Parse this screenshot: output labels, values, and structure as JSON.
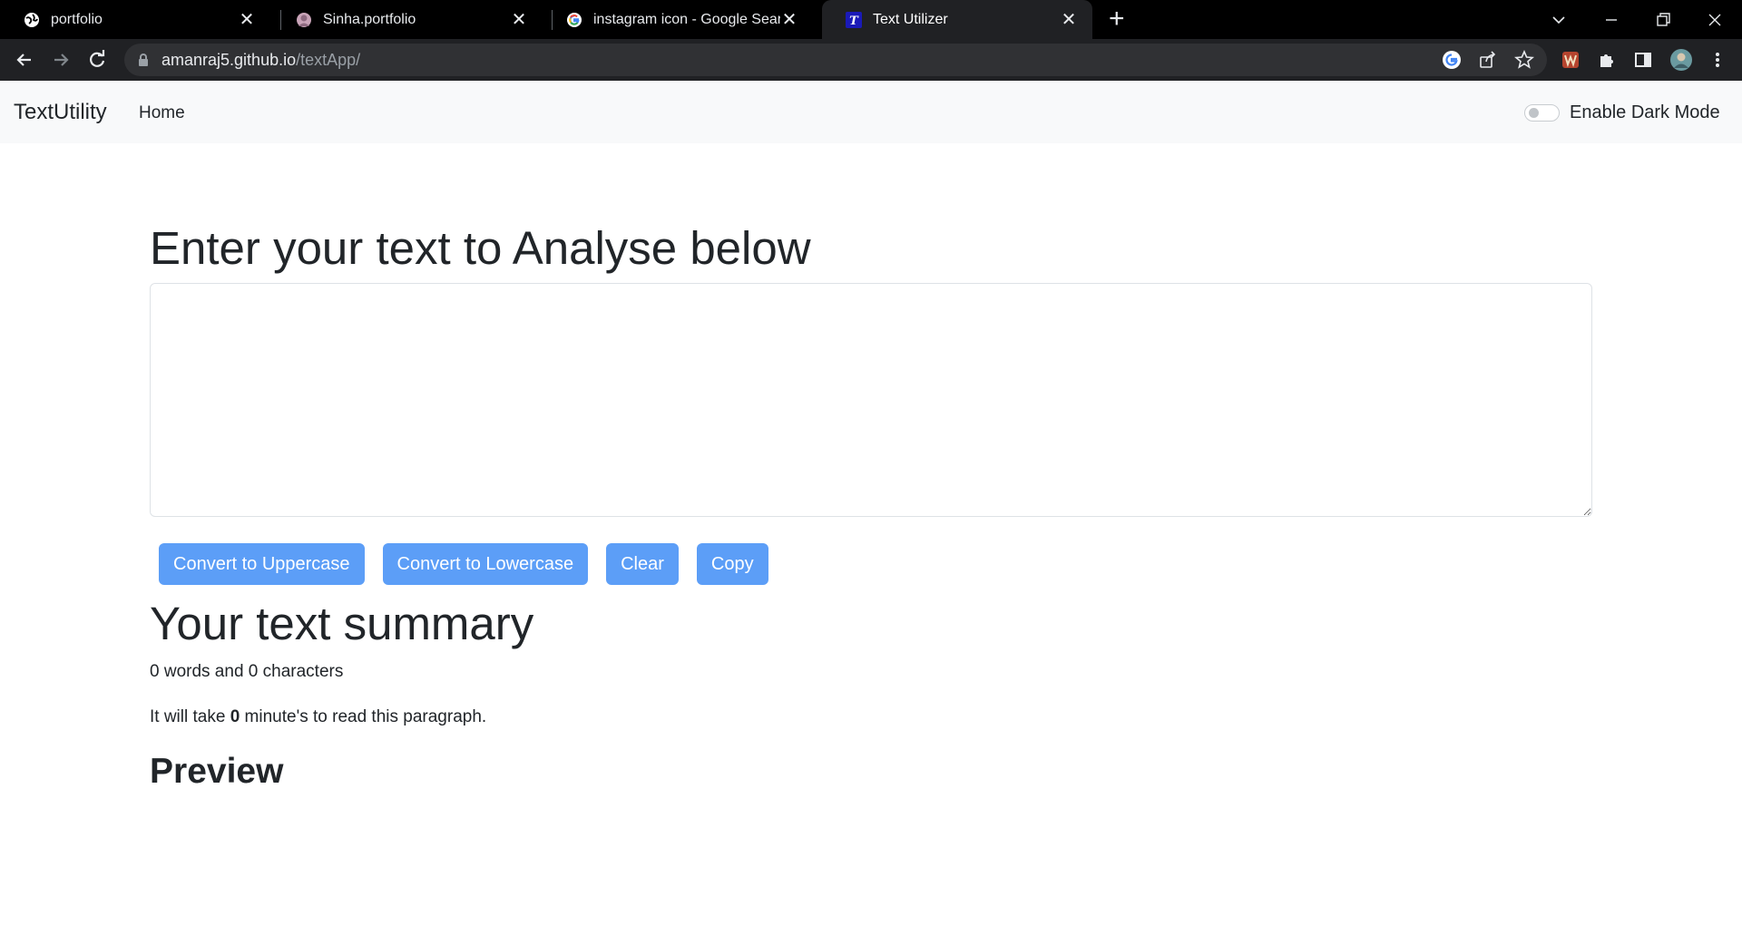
{
  "browser": {
    "tabs": [
      {
        "title": "portfolio",
        "icon": "globe-icon",
        "active": false
      },
      {
        "title": "Sinha.portfolio",
        "icon": "avatar-icon",
        "active": false
      },
      {
        "title": "instagram icon - Google Search",
        "icon": "google-icon",
        "active": false
      },
      {
        "title": "Text Utilizer",
        "icon": "text-t-icon",
        "active": true
      }
    ],
    "url_host": "amanraj5.github.io",
    "url_path": "/textApp/"
  },
  "navbar": {
    "brand": "TextUtility",
    "links": [
      "Home"
    ],
    "dark_mode_label": "Enable Dark Mode",
    "dark_mode_enabled": false
  },
  "main": {
    "heading": "Enter your text to Analyse below",
    "textarea_value": "",
    "buttons": [
      "Convert to Uppercase",
      "Convert to Lowercase",
      "Clear",
      "Copy"
    ],
    "summary_heading": "Your text summary",
    "summary_text": "0 words and 0 characters",
    "read_prefix": "It will take ",
    "read_minutes": "0",
    "read_suffix": " minute's to read this paragraph.",
    "preview_heading": "Preview"
  },
  "colors": {
    "button": "#5c9ef7",
    "navbar_bg": "#f8f9fa",
    "tabstrip_bg": "#000000",
    "toolbar_bg": "#202124"
  }
}
